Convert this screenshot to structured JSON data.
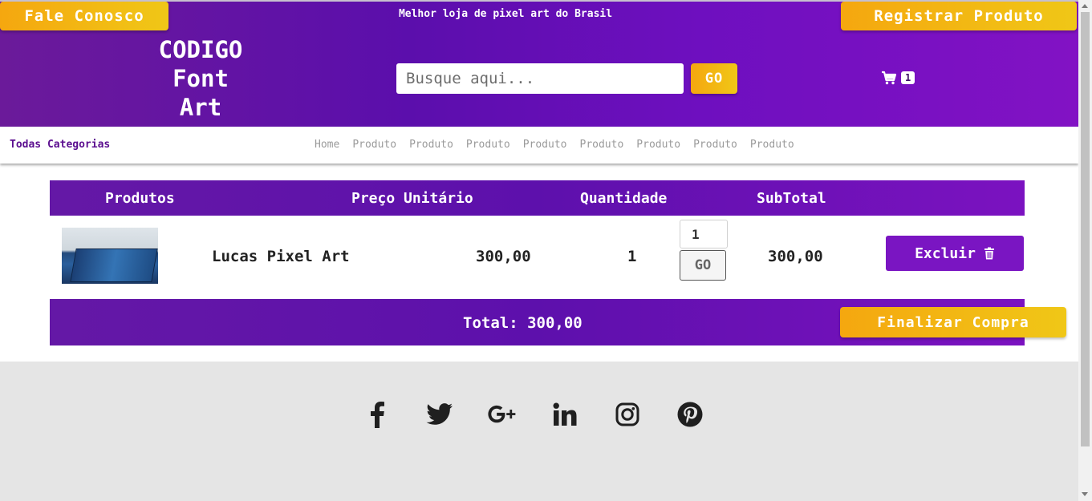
{
  "header": {
    "contact_label": "Fale Conosco",
    "register_label": "Registrar Produto",
    "tagline": "Melhor loja de pixel art do Brasil",
    "logo_lines": [
      "CODIGO",
      "Font",
      "Art"
    ],
    "search_placeholder": "Busque aqui...",
    "search_go_label": "GO",
    "cart_count": "1"
  },
  "nav": {
    "categories_label": "Todas Categorias",
    "items": [
      "Home",
      "Produto",
      "Produto",
      "Produto",
      "Produto",
      "Produto",
      "Produto",
      "Produto",
      "Produto"
    ]
  },
  "cart": {
    "columns": [
      "Produtos",
      "Preço Unitário",
      "Quantidade",
      "SubTotal"
    ],
    "rows": [
      {
        "name": "Lucas Pixel Art",
        "unit_price": "300,00",
        "quantity": "1",
        "quantity_input": "1",
        "update_label": "GO",
        "subtotal": "300,00",
        "delete_label": "Excluir"
      }
    ],
    "total_label": "Total: 300,00",
    "checkout_label": "Finalizar Compra"
  },
  "footer": {
    "social_icons": [
      "facebook-icon",
      "twitter-icon",
      "google-plus-icon",
      "linkedin-icon",
      "instagram-icon",
      "pinterest-icon"
    ]
  },
  "colors": {
    "accent_purple": "#6a12b4",
    "accent_yellow": "#f5b50f",
    "footer_bg": "#e5e5e5"
  }
}
